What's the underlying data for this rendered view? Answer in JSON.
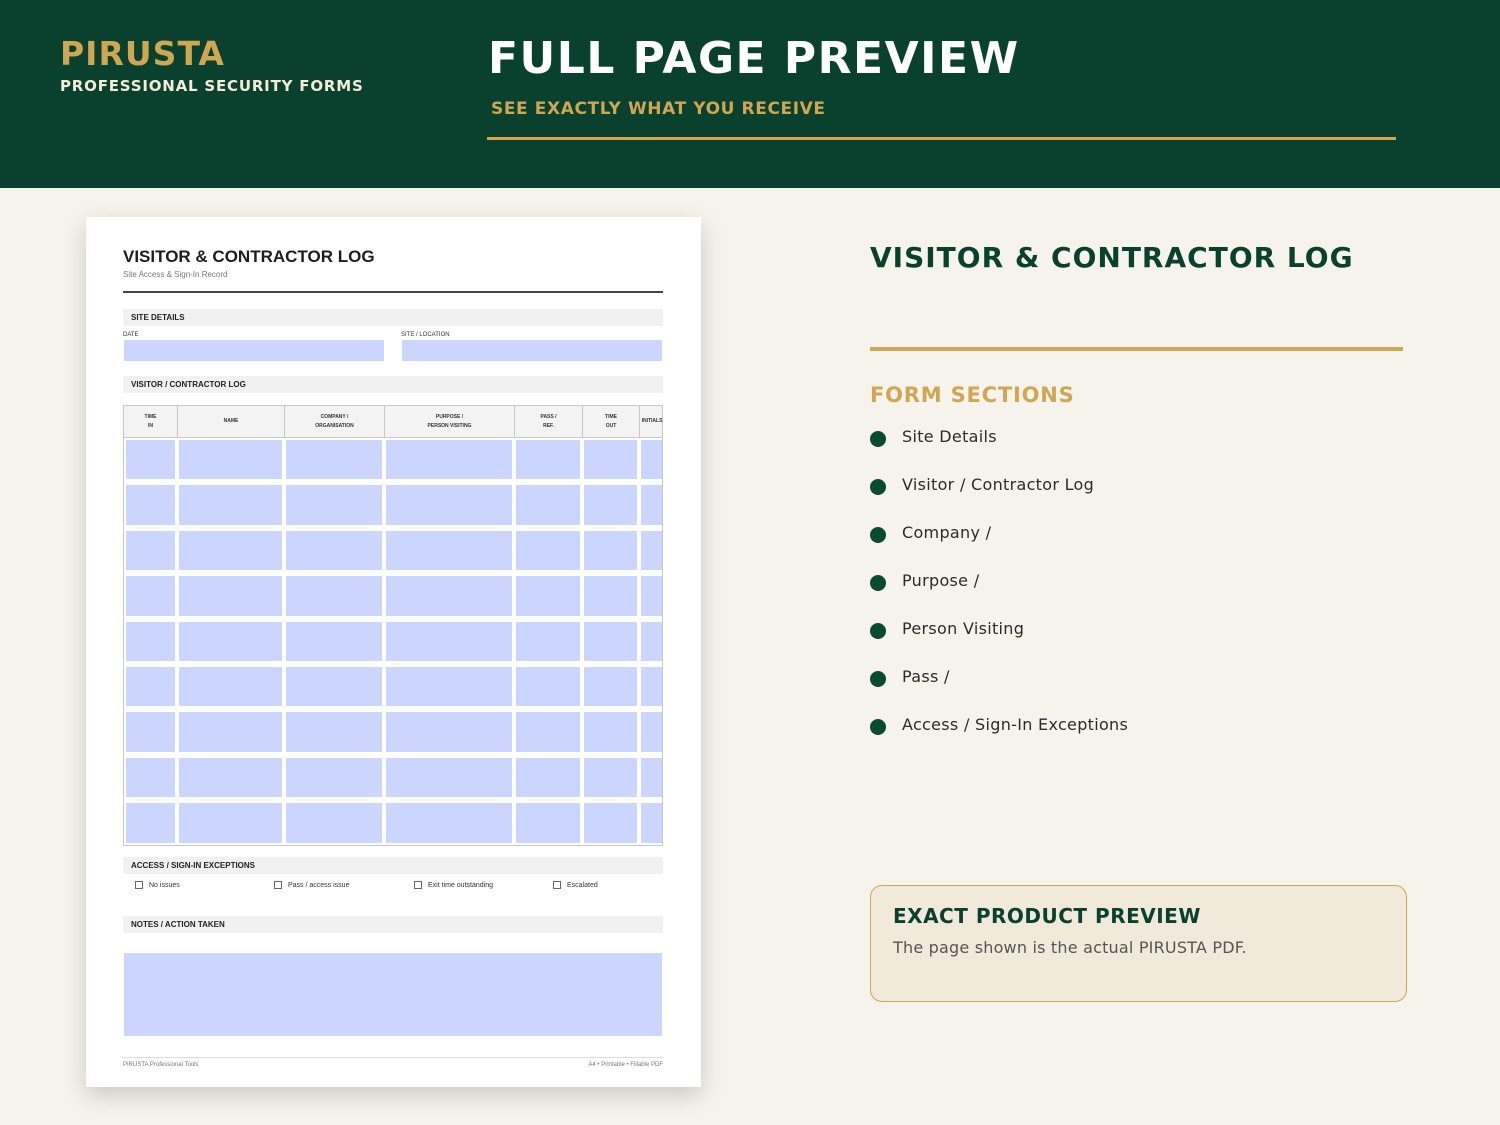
{
  "header": {
    "brand": "PIRUSTA",
    "brand_sub": "PROFESSIONAL SECURITY FORMS",
    "title": "FULL PAGE PREVIEW",
    "subtitle": "SEE EXACTLY WHAT YOU RECEIVE"
  },
  "doc": {
    "title": "VISITOR & CONTRACTOR LOG",
    "subtitle": "Site Access & Sign-In Record",
    "site_details": "SITE DETAILS",
    "date_label": "DATE",
    "site_label": "SITE / LOCATION",
    "log_label": "VISITOR / CONTRACTOR LOG",
    "columns": [
      "TIME\nIN",
      "NAME",
      "COMPANY /\nORGANISATION",
      "PURPOSE /\nPERSON VISITING",
      "PASS /\nREF.",
      "TIME\nOUT",
      "INITIALS"
    ],
    "exceptions_label": "ACCESS / SIGN-IN EXCEPTIONS",
    "checks": [
      "No issues",
      "Pass / access issue",
      "Exit time outstanding",
      "Escalated"
    ],
    "notes_label": "NOTES / ACTION TAKEN",
    "footer_left": "PIRUSTA Professional Tools",
    "footer_right": "A4 • Printable • Fillable PDF"
  },
  "right": {
    "title": "VISITOR & CONTRACTOR LOG",
    "sections_heading": "FORM SECTIONS",
    "sections": [
      "Site Details",
      "Visitor / Contractor Log",
      "Company /",
      "Purpose /",
      "Person Visiting",
      "Pass /",
      "Access / Sign-In Exceptions"
    ]
  },
  "callout": {
    "title": "EXACT PRODUCT PREVIEW",
    "text": "The page shown is the actual PIRUSTA PDF."
  }
}
